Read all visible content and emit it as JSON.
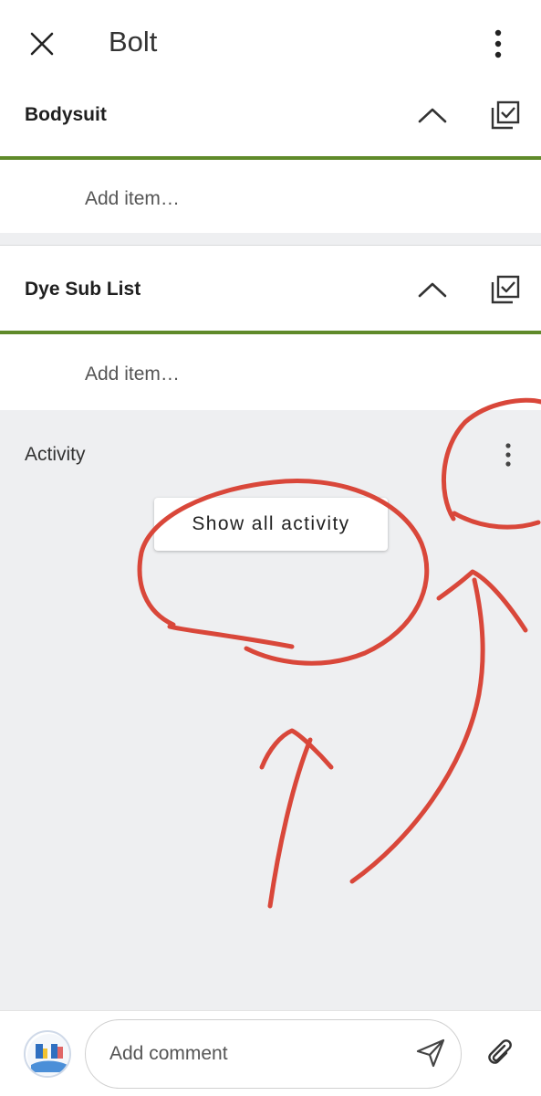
{
  "header": {
    "title": "Bolt"
  },
  "lists": [
    {
      "title": "Bodysuit",
      "add_item_placeholder": "Add item…"
    },
    {
      "title": "Dye Sub List",
      "add_item_placeholder": "Add item…"
    }
  ],
  "activity": {
    "label": "Activity",
    "show_all_label": "Show all activity"
  },
  "comment": {
    "placeholder": "Add comment"
  },
  "colors": {
    "list_accent": "#5f8a2a",
    "activity_background": "#eeeff1",
    "annotation": "#d9473a"
  },
  "icons": [
    "close-icon",
    "more-vert-icon",
    "chevron-up-icon",
    "checklist-done-icon",
    "send-icon",
    "attach-icon"
  ]
}
